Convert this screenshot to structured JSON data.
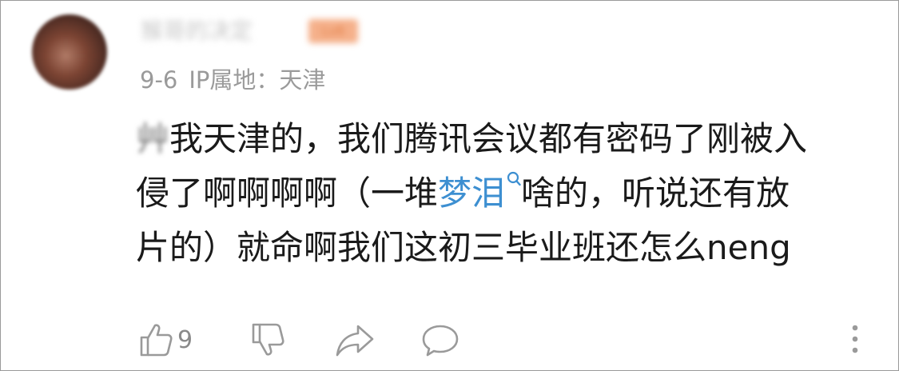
{
  "comment": {
    "author": {
      "name": "猴哥的决定",
      "badge": "Lv6"
    },
    "date": "9-6",
    "ip_location": "IP属地：天津",
    "content": {
      "lead_char": "艸",
      "line1": "我天津的，我们腾讯会议都有密码了刚被入",
      "line2_prefix": "侵了啊啊啊啊（一堆",
      "keyword": "梦泪",
      "line2_suffix": "啥的，听说还有放",
      "line3": "片的）就命啊我们这初三毕业班还怎么neng"
    },
    "actions": {
      "like_count": "9"
    },
    "colors": {
      "text": "#1a1a1a",
      "meta": "#9a9a9a",
      "link": "#3d8fd1",
      "icon": "#9a9a9a"
    },
    "icons": [
      "thumbs-up-icon",
      "thumbs-down-icon",
      "share-icon",
      "comment-icon",
      "more-icon",
      "search-icon"
    ]
  }
}
